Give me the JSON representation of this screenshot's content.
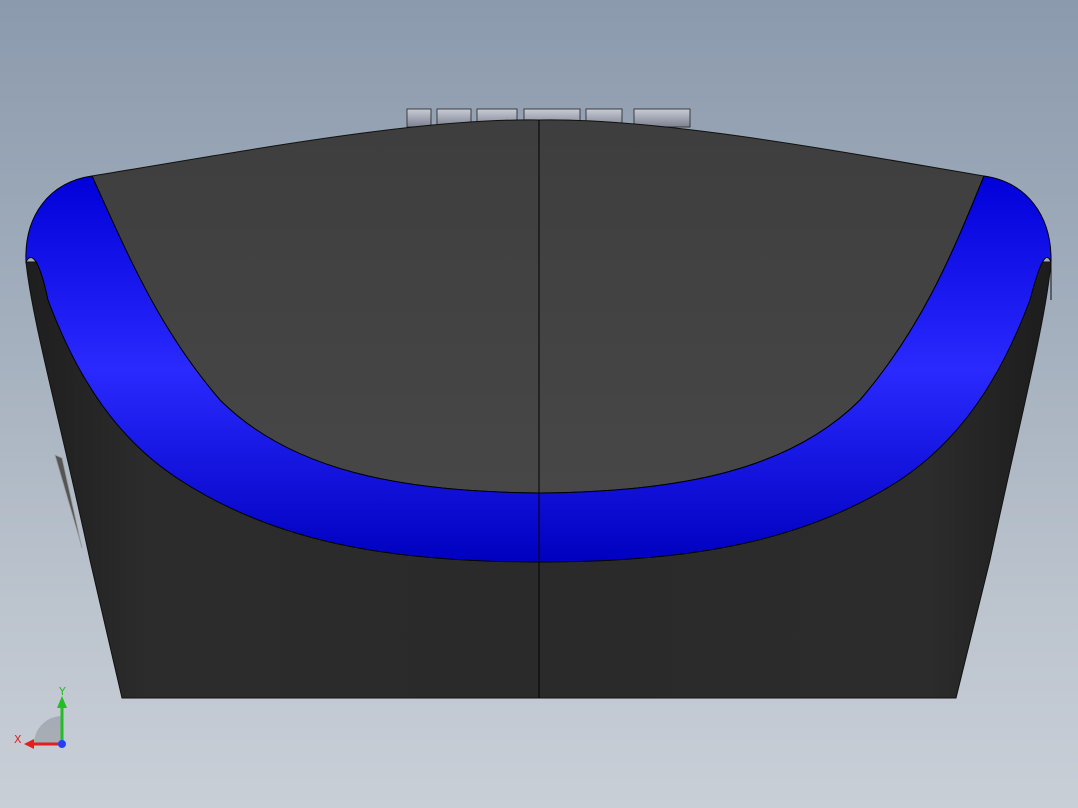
{
  "viewport": {
    "background_top": "#8b9aad",
    "background_bottom": "#c9cfd7",
    "body_color": "#2b2b2b",
    "top_face_color": "#444444",
    "rim_color": "#0a0af0",
    "edge_color": "#000000"
  },
  "triad": {
    "x_label": "X",
    "y_label": "Y",
    "x_color": "#e02020",
    "y_color": "#20c020",
    "z_color": "#2040ff"
  }
}
